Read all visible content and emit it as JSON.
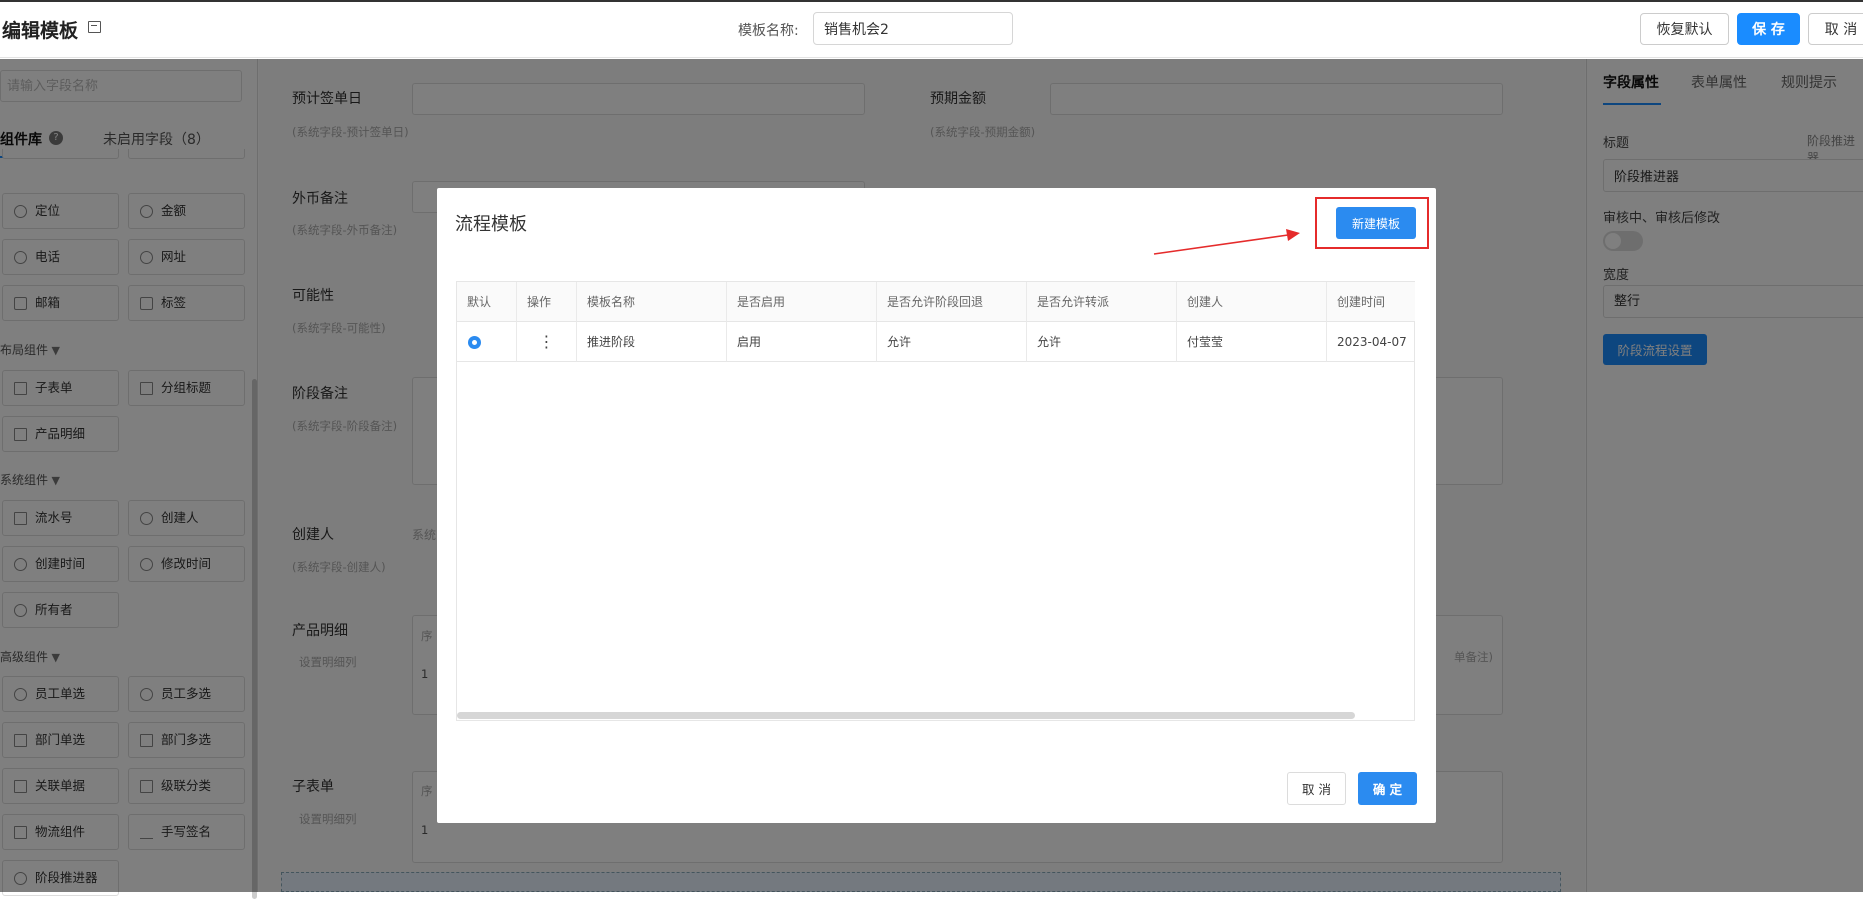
{
  "header": {
    "title": "编辑模板",
    "template_name_label": "模板名称:",
    "template_name_value": "销售机会2",
    "restore_label": "恢复默认",
    "save_label": "保 存",
    "cancel_label": "取 消"
  },
  "left_panel": {
    "search_placeholder": "请输入字段名称",
    "tab_library": "组件库",
    "tab_unused": "未启用字段（8）",
    "basic_components": [
      "定位",
      "金额",
      "电话",
      "网址",
      "邮箱",
      "标签"
    ],
    "layout_group": "布局组件",
    "layout_components": [
      "子表单",
      "分组标题",
      "产品明细"
    ],
    "system_group": "系统组件",
    "system_components": [
      "流水号",
      "创建人",
      "创建时间",
      "修改时间",
      "所有者"
    ],
    "advanced_group": "高级组件",
    "advanced_components": [
      "员工单选",
      "员工多选",
      "部门单选",
      "部门多选",
      "关联单据",
      "级联分类",
      "物流组件",
      "手写签名",
      "阶段推进器"
    ]
  },
  "canvas": {
    "fields": [
      {
        "label": "预计签单日",
        "sub": "(系统字段-预计签单日)"
      },
      {
        "label": "预期金额",
        "sub": "(系统字段-预期金额)"
      },
      {
        "label": "外币备注",
        "sub": "(系统字段-外币备注)"
      },
      {
        "label": "可能性",
        "sub": "(系统字段-可能性)"
      },
      {
        "label": "阶段备注",
        "sub": "(系统字段-阶段备注)"
      },
      {
        "label": "创建人",
        "sub": "(系统字段-创建人)"
      },
      {
        "label": "产品明细",
        "sub": "设置明细列"
      },
      {
        "label": "子表单",
        "sub": "设置明细列"
      }
    ],
    "creator_value": "系统",
    "seq_col": "序",
    "row_no": "1",
    "right_note": "单备注)"
  },
  "right_panel": {
    "tabs": [
      "字段属性",
      "表单属性",
      "规则提示"
    ],
    "title_label": "标题",
    "title_hint": "阶段推进器",
    "title_value": "阶段推进器",
    "edit_label": "审核中、审核后修改",
    "width_label": "宽度",
    "width_value": "整行",
    "stage_button": "阶段流程设置"
  },
  "modal": {
    "title": "流程模板",
    "new_button": "新建模板",
    "columns": [
      "默认",
      "操作",
      "模板名称",
      "是否启用",
      "是否允许阶段回退",
      "是否允许转派",
      "创建人",
      "创建时间"
    ],
    "rows": [
      {
        "default": true,
        "action": "⋮",
        "name": "推进阶段",
        "enabled": "启用",
        "allow_back": "允许",
        "allow_transfer": "允许",
        "creator": "付莹莹",
        "created": "2023-04-07"
      }
    ],
    "cancel_label": "取 消",
    "ok_label": "确 定"
  },
  "colors": {
    "accent": "#1a8cff",
    "highlight": "#e52b2b"
  }
}
